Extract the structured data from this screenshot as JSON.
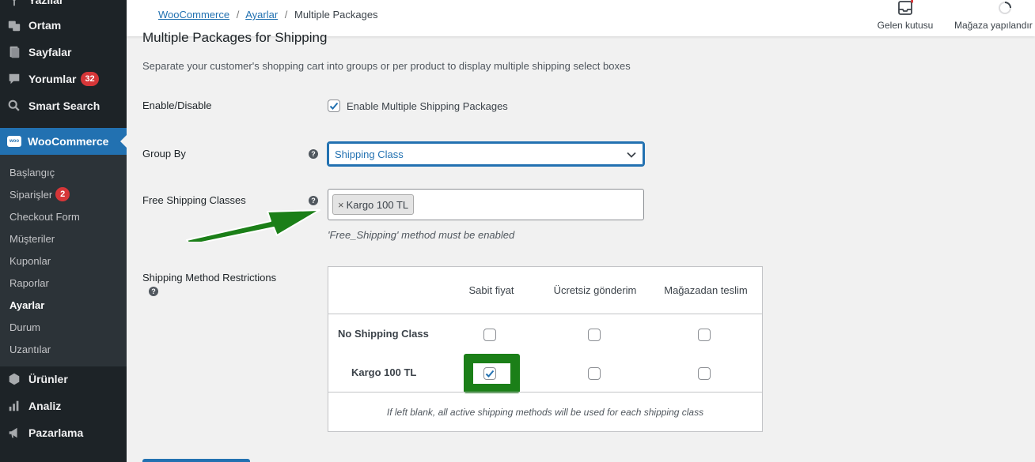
{
  "sidebar": {
    "top_items": [
      {
        "label": "Yazılar",
        "icon": "pin-icon"
      },
      {
        "label": "Ortam",
        "icon": "media-icon"
      },
      {
        "label": "Sayfalar",
        "icon": "pages-icon"
      },
      {
        "label": "Yorumlar",
        "icon": "comments-icon",
        "badge": "32"
      },
      {
        "label": "Smart Search",
        "icon": "search-icon"
      }
    ],
    "woocommerce": {
      "label": "WooCommerce",
      "logo": "woo"
    },
    "submenu": [
      "Başlangıç",
      "Siparişler",
      "Checkout Form",
      "Müşteriler",
      "Kuponlar",
      "Raporlar",
      "Ayarlar",
      "Durum",
      "Uzantılar"
    ],
    "orders_badge": "2",
    "bottom_items": [
      {
        "label": "Ürünler",
        "icon": "products-icon"
      },
      {
        "label": "Analiz",
        "icon": "analytics-icon"
      },
      {
        "label": "Pazarlama",
        "icon": "marketing-icon"
      }
    ]
  },
  "topbar": {
    "breadcrumb": {
      "link1": "WooCommerce",
      "link2": "Ayarlar",
      "sep": "/",
      "current": "Multiple Packages"
    },
    "inbox_label": "Gelen kutusu",
    "store_setup_label": "Mağaza yapılandır"
  },
  "main": {
    "heading": "Multiple Packages for Shipping",
    "description": "Separate your customer's shopping cart into groups or per product to display multiple shipping select boxes",
    "enable": {
      "label": "Enable/Disable",
      "checkbox_label": "Enable Multiple Shipping Packages",
      "checked": true
    },
    "group_by": {
      "label": "Group By",
      "value": "Shipping Class"
    },
    "free_shipping": {
      "label": "Free Shipping Classes",
      "tag": "Kargo 100 TL",
      "tag_remove": "×",
      "note": "'Free_Shipping' method must be enabled"
    },
    "restrictions": {
      "label": "Shipping Method Restrictions",
      "columns": [
        "Sabit fiyat",
        "Ücretsiz gönderim",
        "Mağazadan teslim"
      ],
      "rows": [
        {
          "name": "No Shipping Class",
          "checks": [
            false,
            false,
            false
          ]
        },
        {
          "name": "Kargo 100 TL",
          "checks": [
            true,
            false,
            false
          ]
        }
      ],
      "note": "If left blank, all active shipping methods will be used for each shipping class"
    },
    "help_glyph": "?"
  },
  "colors": {
    "sidebar_bg": "#1d2327",
    "accent": "#2271b1",
    "badge": "#d63638",
    "annotation_green": "#1b7f18"
  }
}
